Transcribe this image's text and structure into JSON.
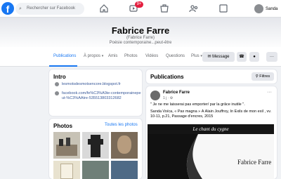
{
  "topbar": {
    "logo": "f",
    "search_placeholder": "Rechercher sur Facebook",
    "notif_badge": "9+",
    "profile_name": "Sanda",
    "icons": [
      "home-icon",
      "video-icon",
      "marketplace-icon",
      "groups-icon",
      "menu-icon",
      "messenger-icon",
      "bell-icon",
      "account-menu-icon"
    ]
  },
  "profile": {
    "name": "Fabrice Farre",
    "alt_name": "(Fabrice Farre)",
    "bio": "Poésie contemporaine...peut-être"
  },
  "tabs": [
    {
      "label": "Publications",
      "active": true
    },
    {
      "label": "À propos"
    },
    {
      "label": "Amis"
    },
    {
      "label": "Photos"
    },
    {
      "label": "Vidéos"
    },
    {
      "label": "Questions"
    },
    {
      "label": "Plus"
    }
  ],
  "actions": {
    "message": "Message"
  },
  "intro": {
    "title": "Intro",
    "links": [
      "lesmotsdesmotsencore.blogspot.fr",
      "facebook.com/fe%C3%A9ie-contemporainepeut-%C3%AAtre-535513803312682"
    ]
  },
  "photos": {
    "title": "Photos",
    "all": "Toutes les photos"
  },
  "publications": {
    "title": "Publications",
    "filter": "Filtres"
  },
  "post": {
    "author": "Fabrice Farre",
    "meta": "1 j · ⚙",
    "lines": [
      "\" Je ne me laisserai pas emporter/ par la grâce inutile \".",
      "Sanda Voïca, « Pax magna » À Alain Jouffroy, In Exils de mon exil , vv.",
      "10-11, p.21, Passage d'encres, 2015"
    ],
    "banner": "Le chant du cygne",
    "image_text": "Fabrice Farre"
  },
  "colors": {
    "brand": "#1877f2",
    "badge": "#e41e3f"
  }
}
